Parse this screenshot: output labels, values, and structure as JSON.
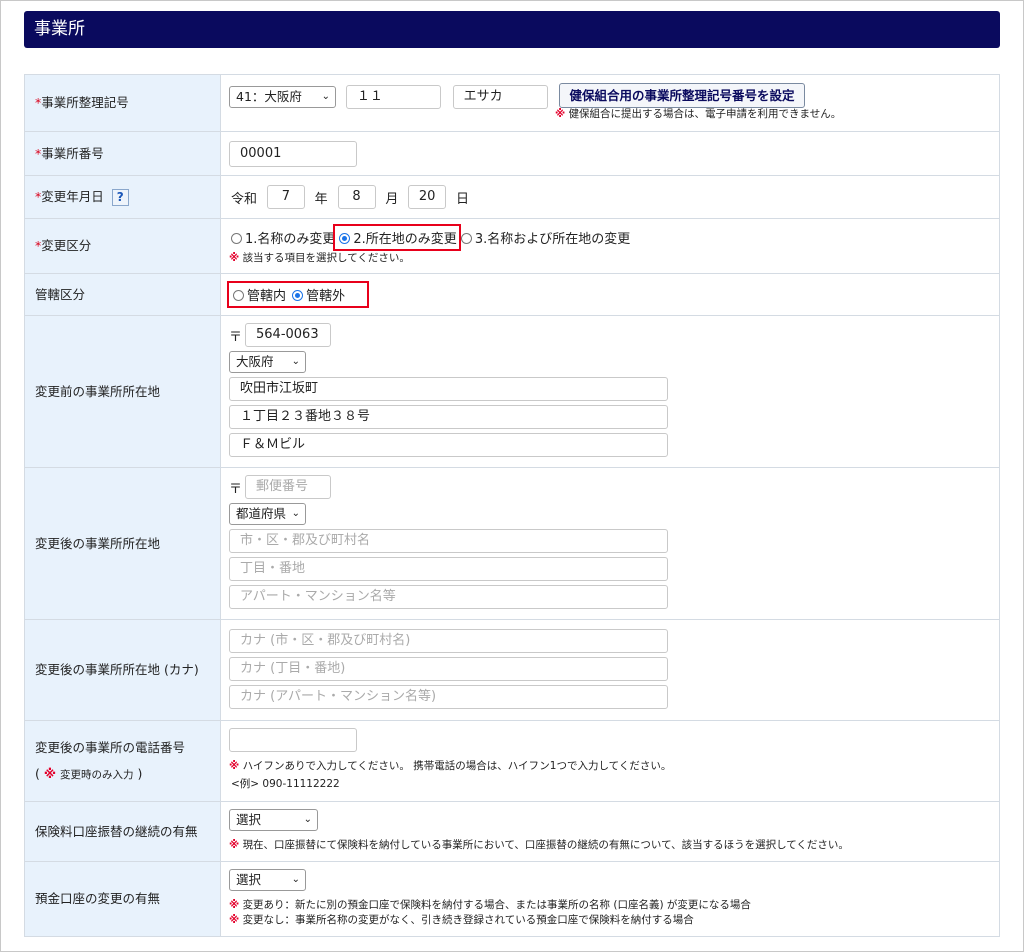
{
  "header": {
    "title": "事業所"
  },
  "fields": {
    "seiri": {
      "label": "事業所整理記号",
      "pref_select": "41：大阪府",
      "code1": "１１",
      "code2": "エサカ",
      "set_button": "健保組合用の事業所整理記号番号を設定",
      "note": "健保組合に提出する場合は、電子申請を利用できません。"
    },
    "office_no": {
      "label": "事業所番号",
      "value": "00001"
    },
    "change_date": {
      "label": "変更年月日",
      "era": "令和",
      "year": "7",
      "year_unit": "年",
      "month": "8",
      "month_unit": "月",
      "day": "20",
      "day_unit": "日"
    },
    "change_type": {
      "label": "変更区分",
      "options": [
        "1.名称のみ変更",
        "2.所在地のみ変更",
        "3.名称および所在地の変更"
      ],
      "selected": "2.所在地のみ変更",
      "note": "該当する項目を選択してください。"
    },
    "jurisdiction": {
      "label": "管轄区分",
      "options": [
        "管轄内",
        "管轄外"
      ],
      "selected": "管轄外"
    },
    "before_address": {
      "label": "変更前の事業所所在地",
      "zip": "564-0063",
      "pref": "大阪府",
      "city": "吹田市江坂町",
      "street": "１丁目２３番地３８号",
      "building": "Ｆ＆Ｍビル"
    },
    "after_address": {
      "label": "変更後の事業所所在地",
      "zip_placeholder": "郵便番号",
      "pref": "都道府県",
      "city_placeholder": "市・区・郡及び町村名",
      "street_placeholder": "丁目・番地",
      "building_placeholder": "アパート・マンション名等"
    },
    "after_address_kana": {
      "label": "変更後の事業所所在地 (カナ)",
      "city_placeholder": "カナ (市・区・郡及び町村名)",
      "street_placeholder": "カナ (丁目・番地)",
      "building_placeholder": "カナ (アパート・マンション名等)"
    },
    "after_phone": {
      "label": "変更後の事業所の電話番号",
      "sub_label": "変更時のみ入力",
      "value": "",
      "note": "ハイフンありで入力してください。 携帯電話の場合は、ハイフン1つで入力してください。",
      "example": "<例> 090-11112222"
    },
    "transfer_continue": {
      "label": "保険料口座振替の継続の有無",
      "select": "選択",
      "note": "現在、口座振替にて保険料を納付している事業所において、口座振替の継続の有無について、該当するほうを選択してください。"
    },
    "account_change": {
      "label": "預金口座の変更の有無",
      "select": "選択",
      "note1": "変更あり：新たに別の預金口座で保険料を納付する場合、または事業所の名称 (口座名義) が変更になる場合",
      "note2": "変更なし：事業所名称の変更がなく、引き続き登録されている預金口座で保険料を納付する場合"
    }
  },
  "symbols": {
    "required": "*",
    "mark": "※",
    "zip": "〒",
    "help": "?",
    "chevron": "⌄"
  },
  "colors": {
    "header_bg": "#0a0a5e",
    "label_bg": "#e8f2fc",
    "required": "#d9001b",
    "highlight": "#e8001b"
  }
}
